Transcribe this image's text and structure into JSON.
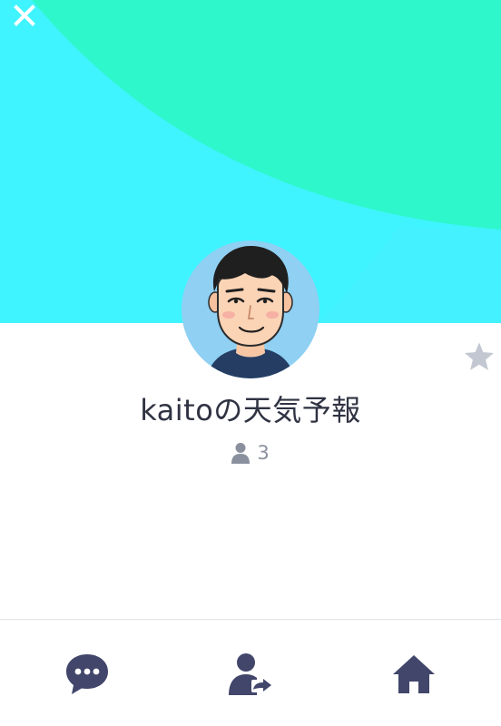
{
  "profile": {
    "name": "kaitoの天気予報",
    "friend_count": "3"
  },
  "icons": {
    "close": "close-icon",
    "favorite": "star-icon",
    "friends": "person-icon",
    "chat": "chat-bubble-icon",
    "share": "share-contact-icon",
    "home": "home-icon"
  },
  "colors": {
    "cover_base": "#3ff4ff",
    "cover_wave": "#2ef7cc",
    "icon_dark": "#41466a",
    "text_primary": "#2f3342",
    "text_secondary": "#8b909e",
    "star_inactive": "#c3c7d1"
  }
}
